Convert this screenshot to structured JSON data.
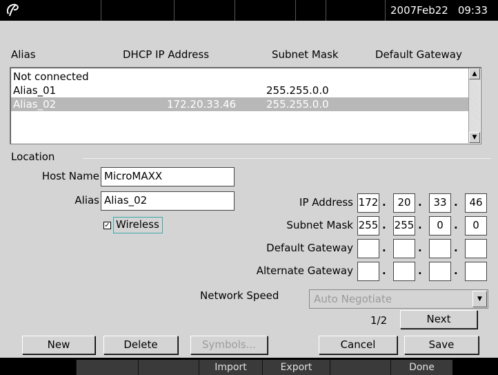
{
  "topbar": {
    "logo_icon": "swirl-logo-icon",
    "date": "2007Feb22",
    "time": "09:33"
  },
  "table": {
    "headers": {
      "alias": "Alias",
      "dhcp_ip": "DHCP IP Address",
      "subnet": "Subnet Mask",
      "gateway": "Default Gateway"
    },
    "rows": [
      {
        "alias": "Not connected",
        "ip": "",
        "subnet": "",
        "gateway": ""
      },
      {
        "alias": "Alias_01",
        "ip": "",
        "subnet": "255.255.0.0",
        "gateway": ""
      },
      {
        "alias": "Alias_02",
        "ip": "172.20.33.46",
        "subnet": "255.255.0.0",
        "gateway": ""
      }
    ],
    "selected_index": 2
  },
  "location": {
    "group_label": "Location",
    "host_name_label": "Host Name",
    "host_name_value": "MicroMAXX",
    "alias_label": "Alias",
    "alias_value": "Alias_02",
    "wireless_label": "Wireless",
    "wireless_checked": true
  },
  "ip": {
    "ip_label": "IP Address",
    "ip_octets": [
      "172",
      "20",
      "33",
      "46"
    ],
    "subnet_label": "Subnet Mask",
    "subnet_octets": [
      "255",
      "255",
      "0",
      "0"
    ],
    "default_gw_label": "Default Gateway",
    "default_gw_octets": [
      "",
      "",
      "",
      ""
    ],
    "alt_gw_label": "Alternate Gateway",
    "alt_gw_octets": [
      "",
      "",
      "",
      ""
    ],
    "dot": "."
  },
  "network_speed": {
    "label": "Network Speed",
    "value": "Auto Negotiate"
  },
  "paging": {
    "page": "1/2",
    "next_label": "Next"
  },
  "buttons": {
    "new": "New",
    "delete": "Delete",
    "symbols": "Symbols...",
    "cancel": "Cancel",
    "save": "Save"
  },
  "softkeys": [
    "",
    "",
    "",
    "Import",
    "Export",
    "",
    "Done",
    ""
  ]
}
